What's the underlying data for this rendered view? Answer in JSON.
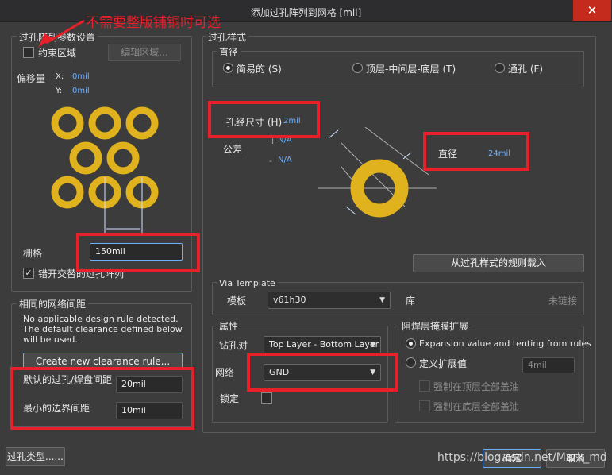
{
  "window": {
    "title": "添加过孔阵列到网格 [mil]",
    "close": "✕"
  },
  "annotation": {
    "text": "不需要整版铺铜时可选"
  },
  "via_array": {
    "group_title": "过孔阵列参数设置",
    "constrain_region": {
      "label": "约束区域",
      "checked": false
    },
    "edit_region_button": "编辑区域...",
    "offset_label": "偏移量",
    "x_label": "X:",
    "x_value": "0mil",
    "y_label": "Y:",
    "y_value": "0mil",
    "grid_label": "栅格",
    "grid_value": "150mil",
    "stagger": {
      "label": "错开交替的过孔阵列",
      "checked": true
    }
  },
  "net_clearance": {
    "group_title": "相同的网络间距",
    "message": "No applicable design rule detected. The default clearance defined below will be used.",
    "create_button": "Create new clearance rule...",
    "default_clearance_label": "默认的过孔/焊盘间距",
    "default_clearance_value": "20mil",
    "min_edge_label": "最小的边界间距",
    "min_edge_value": "10mil"
  },
  "via_style": {
    "group_title": "过孔样式",
    "diameter_group": "直径",
    "options": [
      "简易的 (S)",
      "顶层-中间层-底层 (T)",
      "通孔 (F)"
    ],
    "selected": 0,
    "hole_size_label": "孔经尺寸 (H)",
    "hole_size_value": "2mil",
    "tolerance_label": "公差",
    "tol_plus": "+",
    "tol_plus_value": "N/A",
    "tol_minus": "-",
    "tol_minus_value": "N/A",
    "diameter_label": "直径",
    "diameter_value": "24mil",
    "load_rules_button": "从过孔样式的规则载入"
  },
  "via_template": {
    "group_title": "Via Template",
    "template_label": "模板",
    "template_value": "v61h30",
    "library_label": "库",
    "library_value": "未链接"
  },
  "properties": {
    "group_title": "属性",
    "drill_pair_label": "钻孔对",
    "drill_pair_value": "Top Layer - Bottom Layer",
    "net_label": "网络",
    "net_value": "GND",
    "locked_label": "锁定",
    "locked": false
  },
  "solder_mask": {
    "group_title": "阻焊层掩膜扩展",
    "option_rules": "Expansion value and tenting from rules",
    "option_custom": "定义扩展值",
    "custom_value": "4mil",
    "force_top": "强制在顶层全部盖油",
    "force_bottom": "强制在底层全部盖油",
    "selected": 0
  },
  "footer": {
    "via_type_button": "过孔类型......",
    "ok_button": "确定",
    "cancel_button": "取消",
    "watermark": "https://blog.csdn.net/Mark_md"
  },
  "colors": {
    "via_ring": "#e0b21e",
    "highlight": "#e8202a",
    "accent_text": "#6ab0ff"
  }
}
